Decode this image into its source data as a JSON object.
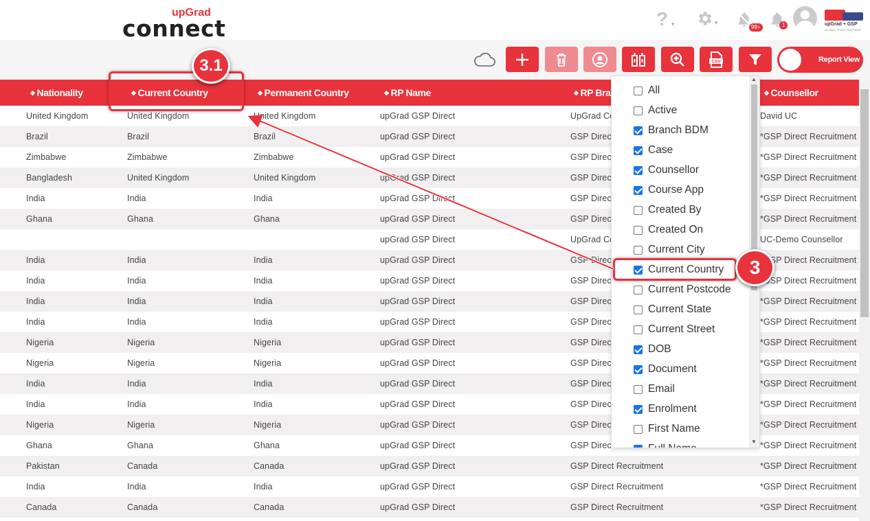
{
  "brand": {
    "logo_small": "upGrad",
    "logo_main": "connect",
    "partner_text": "upGrad + GSP",
    "partner_sub": "GLOBAL STUDY PARTNERS"
  },
  "header_icons": {
    "help": "question-icon",
    "settings": "gear-icon",
    "notifications_badge": "99+",
    "alerts_badge": "1"
  },
  "toolbar": {
    "report_view_label": "Report View"
  },
  "colors": {
    "accent": "#e8323c",
    "checkbox": "#1a73e8"
  },
  "table": {
    "columns": [
      "Nationality",
      "Current Country",
      "Permanent Country",
      "RP Name",
      "RP Branch",
      "Counsellor"
    ],
    "rows": [
      [
        "United Kingdom",
        "United Kingdom",
        "United Kingdom",
        "upGrad GSP Direct",
        "UpGrad Co",
        "David UC"
      ],
      [
        "Brazil",
        "Brazil",
        "Brazil",
        "upGrad GSP Direct",
        "GSP Direct",
        "*GSP Direct Recruitment"
      ],
      [
        "Zimbabwe",
        "Zimbabwe",
        "Zimbabwe",
        "upGrad GSP Direct",
        "GSP Direct",
        "*GSP Direct Recruitment"
      ],
      [
        "Bangladesh",
        "United Kingdom",
        "United Kingdom",
        "upGrad GSP Direct",
        "GSP Direct",
        "*GSP Direct Recruitment"
      ],
      [
        "India",
        "India",
        "India",
        "upGrad GSP Direct",
        "GSP Direct",
        "*GSP Direct Recruitment"
      ],
      [
        "Ghana",
        "Ghana",
        "Ghana",
        "upGrad GSP Direct",
        "GSP Direct",
        "*GSP Direct Recruitment"
      ],
      [
        "",
        "",
        "",
        "upGrad GSP Direct",
        "UpGrad Co",
        "UC-Demo Counsellor"
      ],
      [
        "India",
        "India",
        "India",
        "upGrad GSP Direct",
        "GSP Direct",
        "*GSP Direct Recruitment"
      ],
      [
        "India",
        "India",
        "India",
        "upGrad GSP Direct",
        "GSP Direct",
        "*GSP Direct Recruitment"
      ],
      [
        "India",
        "India",
        "India",
        "upGrad GSP Direct",
        "GSP Direct",
        "*GSP Direct Recruitment"
      ],
      [
        "India",
        "India",
        "India",
        "upGrad GSP Direct",
        "GSP Direct",
        "*GSP Direct Recruitment"
      ],
      [
        "Nigeria",
        "Nigeria",
        "Nigeria",
        "upGrad GSP Direct",
        "GSP Direct",
        "*GSP Direct Recruitment"
      ],
      [
        "Nigeria",
        "Nigeria",
        "Nigeria",
        "upGrad GSP Direct",
        "GSP Direct",
        "*GSP Direct Recruitment"
      ],
      [
        "India",
        "India",
        "India",
        "upGrad GSP Direct",
        "GSP Direct",
        "*GSP Direct Recruitment"
      ],
      [
        "India",
        "India",
        "India",
        "upGrad GSP Direct",
        "GSP Direct",
        "*GSP Direct Recruitment"
      ],
      [
        "Nigeria",
        "Nigeria",
        "Nigeria",
        "upGrad GSP Direct",
        "GSP Direct",
        "*GSP Direct Recruitment"
      ],
      [
        "Ghana",
        "Ghana",
        "Ghana",
        "upGrad GSP Direct",
        "GSP Direct",
        "*GSP Direct Recruitment"
      ],
      [
        "Pakistan",
        "Canada",
        "Canada",
        "upGrad GSP Direct",
        "GSP Direct Recruitment",
        "*GSP Direct Recruitment"
      ],
      [
        "India",
        "India",
        "India",
        "upGrad GSP Direct",
        "GSP Direct Recruitment",
        "*GSP Direct Recruitment"
      ],
      [
        "Canada",
        "Canada",
        "Canada",
        "upGrad GSP Direct",
        "GSP Direct Recruitment",
        "*GSP Direct Recruitment"
      ]
    ]
  },
  "column_picker": {
    "items": [
      {
        "label": "All",
        "checked": false
      },
      {
        "label": "Active",
        "checked": false
      },
      {
        "label": "Branch BDM",
        "checked": true
      },
      {
        "label": "Case",
        "checked": true
      },
      {
        "label": "Counsellor",
        "checked": true
      },
      {
        "label": "Course App",
        "checked": true
      },
      {
        "label": "Created By",
        "checked": false
      },
      {
        "label": "Created On",
        "checked": false
      },
      {
        "label": "Current City",
        "checked": false
      },
      {
        "label": "Current Country",
        "checked": true
      },
      {
        "label": "Current Postcode",
        "checked": false
      },
      {
        "label": "Current State",
        "checked": false
      },
      {
        "label": "Current Street",
        "checked": false
      },
      {
        "label": "DOB",
        "checked": true
      },
      {
        "label": "Document",
        "checked": true
      },
      {
        "label": "Email",
        "checked": false
      },
      {
        "label": "Enrolment",
        "checked": true
      },
      {
        "label": "First Name",
        "checked": false
      },
      {
        "label": "Full Name",
        "checked": true
      }
    ]
  },
  "annotations": {
    "step_a": "3.1",
    "step_b": "3"
  }
}
